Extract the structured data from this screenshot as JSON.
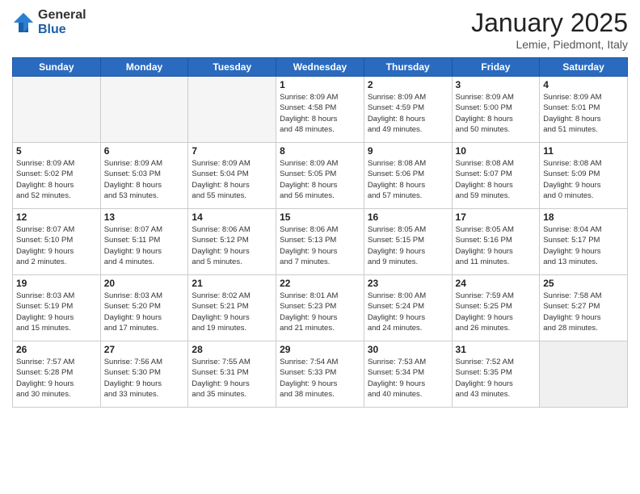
{
  "header": {
    "logo_general": "General",
    "logo_blue": "Blue",
    "month_title": "January 2025",
    "location": "Lemie, Piedmont, Italy"
  },
  "weekdays": [
    "Sunday",
    "Monday",
    "Tuesday",
    "Wednesday",
    "Thursday",
    "Friday",
    "Saturday"
  ],
  "weeks": [
    [
      {
        "day": "",
        "info": ""
      },
      {
        "day": "",
        "info": ""
      },
      {
        "day": "",
        "info": ""
      },
      {
        "day": "1",
        "info": "Sunrise: 8:09 AM\nSunset: 4:58 PM\nDaylight: 8 hours\nand 48 minutes."
      },
      {
        "day": "2",
        "info": "Sunrise: 8:09 AM\nSunset: 4:59 PM\nDaylight: 8 hours\nand 49 minutes."
      },
      {
        "day": "3",
        "info": "Sunrise: 8:09 AM\nSunset: 5:00 PM\nDaylight: 8 hours\nand 50 minutes."
      },
      {
        "day": "4",
        "info": "Sunrise: 8:09 AM\nSunset: 5:01 PM\nDaylight: 8 hours\nand 51 minutes."
      }
    ],
    [
      {
        "day": "5",
        "info": "Sunrise: 8:09 AM\nSunset: 5:02 PM\nDaylight: 8 hours\nand 52 minutes."
      },
      {
        "day": "6",
        "info": "Sunrise: 8:09 AM\nSunset: 5:03 PM\nDaylight: 8 hours\nand 53 minutes."
      },
      {
        "day": "7",
        "info": "Sunrise: 8:09 AM\nSunset: 5:04 PM\nDaylight: 8 hours\nand 55 minutes."
      },
      {
        "day": "8",
        "info": "Sunrise: 8:09 AM\nSunset: 5:05 PM\nDaylight: 8 hours\nand 56 minutes."
      },
      {
        "day": "9",
        "info": "Sunrise: 8:08 AM\nSunset: 5:06 PM\nDaylight: 8 hours\nand 57 minutes."
      },
      {
        "day": "10",
        "info": "Sunrise: 8:08 AM\nSunset: 5:07 PM\nDaylight: 8 hours\nand 59 minutes."
      },
      {
        "day": "11",
        "info": "Sunrise: 8:08 AM\nSunset: 5:09 PM\nDaylight: 9 hours\nand 0 minutes."
      }
    ],
    [
      {
        "day": "12",
        "info": "Sunrise: 8:07 AM\nSunset: 5:10 PM\nDaylight: 9 hours\nand 2 minutes."
      },
      {
        "day": "13",
        "info": "Sunrise: 8:07 AM\nSunset: 5:11 PM\nDaylight: 9 hours\nand 4 minutes."
      },
      {
        "day": "14",
        "info": "Sunrise: 8:06 AM\nSunset: 5:12 PM\nDaylight: 9 hours\nand 5 minutes."
      },
      {
        "day": "15",
        "info": "Sunrise: 8:06 AM\nSunset: 5:13 PM\nDaylight: 9 hours\nand 7 minutes."
      },
      {
        "day": "16",
        "info": "Sunrise: 8:05 AM\nSunset: 5:15 PM\nDaylight: 9 hours\nand 9 minutes."
      },
      {
        "day": "17",
        "info": "Sunrise: 8:05 AM\nSunset: 5:16 PM\nDaylight: 9 hours\nand 11 minutes."
      },
      {
        "day": "18",
        "info": "Sunrise: 8:04 AM\nSunset: 5:17 PM\nDaylight: 9 hours\nand 13 minutes."
      }
    ],
    [
      {
        "day": "19",
        "info": "Sunrise: 8:03 AM\nSunset: 5:19 PM\nDaylight: 9 hours\nand 15 minutes."
      },
      {
        "day": "20",
        "info": "Sunrise: 8:03 AM\nSunset: 5:20 PM\nDaylight: 9 hours\nand 17 minutes."
      },
      {
        "day": "21",
        "info": "Sunrise: 8:02 AM\nSunset: 5:21 PM\nDaylight: 9 hours\nand 19 minutes."
      },
      {
        "day": "22",
        "info": "Sunrise: 8:01 AM\nSunset: 5:23 PM\nDaylight: 9 hours\nand 21 minutes."
      },
      {
        "day": "23",
        "info": "Sunrise: 8:00 AM\nSunset: 5:24 PM\nDaylight: 9 hours\nand 24 minutes."
      },
      {
        "day": "24",
        "info": "Sunrise: 7:59 AM\nSunset: 5:25 PM\nDaylight: 9 hours\nand 26 minutes."
      },
      {
        "day": "25",
        "info": "Sunrise: 7:58 AM\nSunset: 5:27 PM\nDaylight: 9 hours\nand 28 minutes."
      }
    ],
    [
      {
        "day": "26",
        "info": "Sunrise: 7:57 AM\nSunset: 5:28 PM\nDaylight: 9 hours\nand 30 minutes."
      },
      {
        "day": "27",
        "info": "Sunrise: 7:56 AM\nSunset: 5:30 PM\nDaylight: 9 hours\nand 33 minutes."
      },
      {
        "day": "28",
        "info": "Sunrise: 7:55 AM\nSunset: 5:31 PM\nDaylight: 9 hours\nand 35 minutes."
      },
      {
        "day": "29",
        "info": "Sunrise: 7:54 AM\nSunset: 5:33 PM\nDaylight: 9 hours\nand 38 minutes."
      },
      {
        "day": "30",
        "info": "Sunrise: 7:53 AM\nSunset: 5:34 PM\nDaylight: 9 hours\nand 40 minutes."
      },
      {
        "day": "31",
        "info": "Sunrise: 7:52 AM\nSunset: 5:35 PM\nDaylight: 9 hours\nand 43 minutes."
      },
      {
        "day": "",
        "info": ""
      }
    ]
  ]
}
